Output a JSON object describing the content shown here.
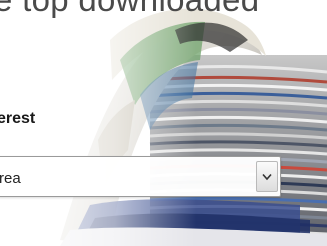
{
  "header": {
    "headline_fragment": "e top downloaded"
  },
  "form": {
    "label_fragment": "erest",
    "select": {
      "selected_fragment": "rea",
      "arrow_icon": "chevron-down-icon"
    }
  },
  "colors": {
    "headline": "#4a4a4a",
    "label": "#1a1a1a",
    "select_border": "#9a9a9a"
  },
  "images": {
    "hero": "stack-of-magazines-image"
  }
}
